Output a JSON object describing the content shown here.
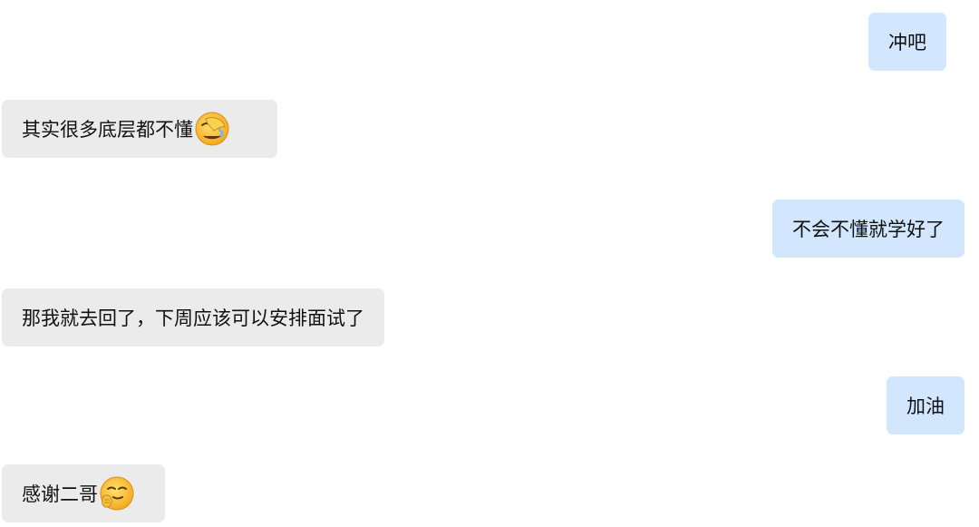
{
  "messages": [
    {
      "side": "sent",
      "text": "冲吧",
      "emoji": null
    },
    {
      "side": "received",
      "text": "其实很多底层都不懂",
      "emoji": "facepalm-emoji"
    },
    {
      "side": "sent",
      "text": "不会不懂就学好了",
      "emoji": null
    },
    {
      "side": "received",
      "text": "那我就去回了，下周应该可以安排面试了",
      "emoji": null
    },
    {
      "side": "sent",
      "text": "加油",
      "emoji": null
    },
    {
      "side": "received",
      "text": "感谢二哥",
      "emoji": "thank-you-emoji"
    }
  ],
  "colors": {
    "sent_bubble": "#d2e6fe",
    "received_bubble": "#ebebeb",
    "text": "#111111",
    "emoji_face": "#f6c22e"
  }
}
